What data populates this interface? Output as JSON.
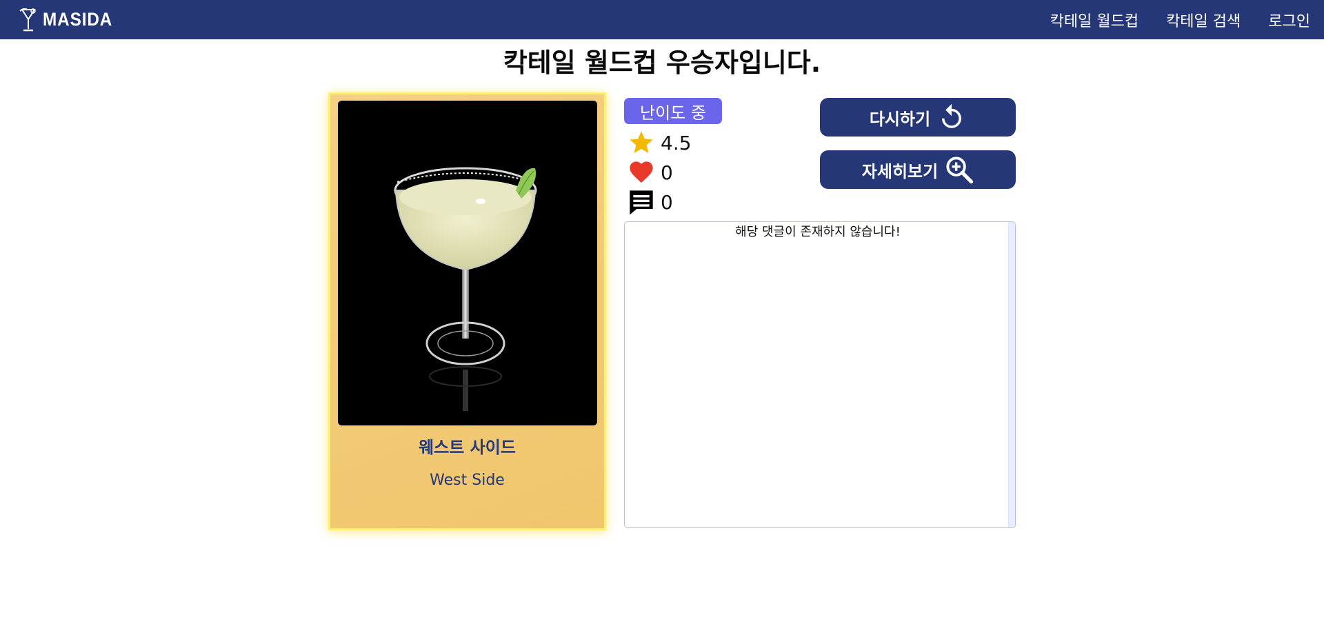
{
  "nav": {
    "brand": "Masida",
    "links": [
      "칵테일 월드컵",
      "칵테일 검색",
      "로그인"
    ]
  },
  "page": {
    "title": "칵테일 월드컵 우승자입니다."
  },
  "cocktail": {
    "name_ko": "웨스트 사이드",
    "name_en": "West Side",
    "difficulty": "난이도 중",
    "rating": "4.5",
    "likes": "0",
    "comments": "0"
  },
  "actions": {
    "retry": "다시하기",
    "details": "자세히보기"
  },
  "comments": {
    "empty_message": "해당 댓글이 존재하지 않습니다!"
  },
  "colors": {
    "navbar": "#253776",
    "badge": "#6a65ea",
    "star": "#f5b800",
    "heart": "#e8392b",
    "card_border": "#ffef77"
  },
  "icons": {
    "brand": "cocktail-glass-icon",
    "rating": "star-icon",
    "likes": "heart-icon",
    "comments": "comment-icon",
    "retry": "refresh-icon",
    "details": "magnify-plus-icon"
  }
}
